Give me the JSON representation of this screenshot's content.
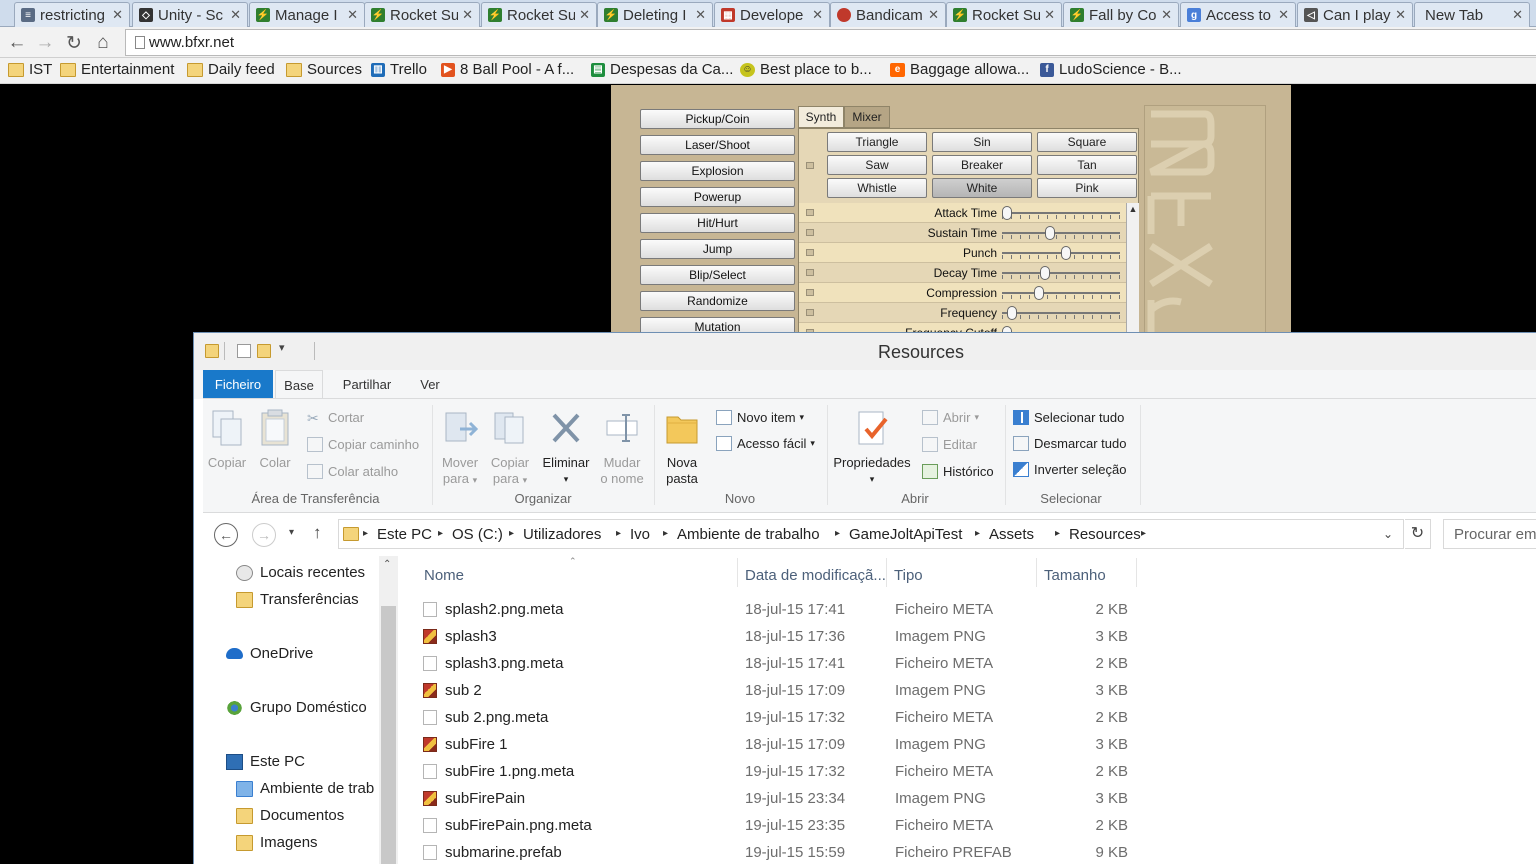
{
  "browser": {
    "tabs": [
      {
        "label": "restricting",
        "icon": "stackoverflow-icon",
        "color": "#5a6b84"
      },
      {
        "label": "Unity - Sc",
        "icon": "unity-icon",
        "color": "#333333"
      },
      {
        "label": "Manage I",
        "icon": "gamejolt-icon",
        "color": "#2f7f2f"
      },
      {
        "label": "Rocket Su",
        "icon": "gamejolt-icon",
        "color": "#2f7f2f"
      },
      {
        "label": "Rocket Su",
        "icon": "gamejolt-icon",
        "color": "#2f7f2f"
      },
      {
        "label": "Deleting I",
        "icon": "gamejolt-icon",
        "color": "#2f7f2f"
      },
      {
        "label": "Develope",
        "icon": "calendar-icon",
        "color": "#c0392b"
      },
      {
        "label": "Bandicam",
        "icon": "bandicam-icon",
        "color": "#c0392b"
      },
      {
        "label": "Rocket Su",
        "icon": "gamejolt-icon",
        "color": "#2f7f2f"
      },
      {
        "label": "Fall by Co",
        "icon": "gamejolt-icon",
        "color": "#2f7f2f"
      },
      {
        "label": "Access to",
        "icon": "google-icon",
        "color": "#4a7fd8"
      },
      {
        "label": "Can I play",
        "icon": "send-icon",
        "color": "#555555"
      },
      {
        "label": "New Tab",
        "icon": "",
        "color": ""
      }
    ],
    "url": "www.bfxr.net",
    "bookmarks": [
      {
        "label": "IST",
        "icon": "folder-icon"
      },
      {
        "label": "Entertainment",
        "icon": "folder-icon"
      },
      {
        "label": "Daily feed",
        "icon": "folder-icon"
      },
      {
        "label": "Sources",
        "icon": "folder-icon"
      },
      {
        "label": "Trello",
        "icon": "trello-icon"
      },
      {
        "label": "8 Ball Pool - A f...",
        "icon": "play-icon"
      },
      {
        "label": "Despesas da Ca...",
        "icon": "sheets-icon"
      },
      {
        "label": "Best place to b...",
        "icon": "smiley-icon"
      },
      {
        "label": "Baggage allowa...",
        "icon": "easyjet-icon"
      },
      {
        "label": "LudoScience - B...",
        "icon": "facebook-icon"
      }
    ]
  },
  "bfxr": {
    "generators": [
      "Pickup/Coin",
      "Laser/Shoot",
      "Explosion",
      "Powerup",
      "Hit/Hurt",
      "Jump",
      "Blip/Select",
      "Randomize",
      "Mutation"
    ],
    "tabs": {
      "synth": "Synth",
      "mixer": "Mixer"
    },
    "waveforms": [
      "Triangle",
      "Sin",
      "Square",
      "Saw",
      "Breaker",
      "Tan",
      "Whistle",
      "White",
      "Pink"
    ],
    "selected_waveform": "White",
    "params": [
      {
        "label": "Attack Time",
        "value": 0.0
      },
      {
        "label": "Sustain Time",
        "value": 0.4
      },
      {
        "label": "Punch",
        "value": 0.55
      },
      {
        "label": "Decay Time",
        "value": 0.35
      },
      {
        "label": "Compression",
        "value": 0.3
      },
      {
        "label": "Frequency",
        "value": 0.05
      },
      {
        "label": "Frequency Cutoff",
        "value": 0.0
      }
    ],
    "logo_text": "Bfxr"
  },
  "explorer": {
    "title": "Resources",
    "ribbon_tabs": {
      "file": "Ficheiro",
      "base": "Base",
      "share": "Partilhar",
      "view": "Ver"
    },
    "clipboard": {
      "copy": "Copiar",
      "paste": "Colar",
      "cut": "Cortar",
      "copy_path": "Copiar caminho",
      "paste_shortcut": "Colar atalho",
      "label": "Área de Transferência"
    },
    "organize": {
      "move_to_1": "Mover",
      "move_to_2": "para",
      "copy_to_1": "Copiar",
      "copy_to_2": "para",
      "delete": "Eliminar",
      "rename_1": "Mudar",
      "rename_2": "o nome",
      "label": "Organizar"
    },
    "new": {
      "new_folder_1": "Nova",
      "new_folder_2": "pasta",
      "new_item": "Novo item",
      "easy_access": "Acesso fácil",
      "label": "Novo"
    },
    "open": {
      "properties": "Propriedades",
      "open": "Abrir",
      "edit": "Editar",
      "history": "Histórico",
      "label": "Abrir"
    },
    "select": {
      "select_all": "Selecionar tudo",
      "select_none": "Desmarcar tudo",
      "invert": "Inverter seleção",
      "label": "Selecionar"
    },
    "breadcrumb": [
      "Este PC",
      "OS (C:)",
      "Utilizadores",
      "Ivo",
      "Ambiente de trabalho",
      "GameJoltApiTest",
      "Assets",
      "Resources"
    ],
    "search_placeholder": "Procurar em",
    "nav_items": [
      {
        "label": "Locais recentes",
        "icon": "recent-icon"
      },
      {
        "label": "Transferências",
        "icon": "downloads-icon"
      },
      {
        "label": "OneDrive",
        "icon": "onedrive-icon"
      },
      {
        "label": "Grupo Doméstico",
        "icon": "homegroup-icon"
      },
      {
        "label": "Este PC",
        "icon": "pc-icon"
      },
      {
        "label": "Ambiente de trab",
        "icon": "desktop-icon"
      },
      {
        "label": "Documentos",
        "icon": "documents-icon"
      },
      {
        "label": "Imagens",
        "icon": "pictures-icon"
      }
    ],
    "columns": {
      "name": "Nome",
      "date": "Data de modificaçã...",
      "type": "Tipo",
      "size": "Tamanho"
    },
    "files": [
      {
        "name": "splash2.png.meta",
        "date": "18-jul-15 17:41",
        "type": "Ficheiro META",
        "size": "2 KB",
        "kind": "doc"
      },
      {
        "name": "splash3",
        "date": "18-jul-15 17:36",
        "type": "Imagem PNG",
        "size": "3 KB",
        "kind": "png"
      },
      {
        "name": "splash3.png.meta",
        "date": "18-jul-15 17:41",
        "type": "Ficheiro META",
        "size": "2 KB",
        "kind": "doc"
      },
      {
        "name": "sub 2",
        "date": "18-jul-15 17:09",
        "type": "Imagem PNG",
        "size": "3 KB",
        "kind": "png"
      },
      {
        "name": "sub 2.png.meta",
        "date": "19-jul-15 17:32",
        "type": "Ficheiro META",
        "size": "2 KB",
        "kind": "doc"
      },
      {
        "name": "subFire 1",
        "date": "18-jul-15 17:09",
        "type": "Imagem PNG",
        "size": "3 KB",
        "kind": "png"
      },
      {
        "name": "subFire 1.png.meta",
        "date": "19-jul-15 17:32",
        "type": "Ficheiro META",
        "size": "2 KB",
        "kind": "doc"
      },
      {
        "name": "subFirePain",
        "date": "19-jul-15 23:34",
        "type": "Imagem PNG",
        "size": "3 KB",
        "kind": "png"
      },
      {
        "name": "subFirePain.png.meta",
        "date": "19-jul-15 23:35",
        "type": "Ficheiro META",
        "size": "2 KB",
        "kind": "doc"
      },
      {
        "name": "submarine.prefab",
        "date": "19-jul-15 15:59",
        "type": "Ficheiro PREFAB",
        "size": "9 KB",
        "kind": "doc"
      }
    ]
  }
}
